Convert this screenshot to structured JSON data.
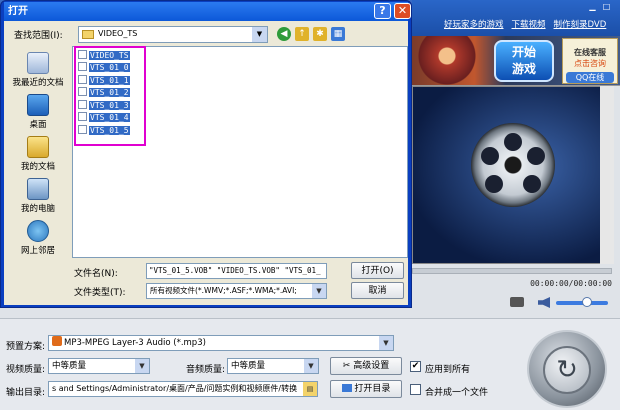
{
  "app": {
    "links": [
      "好玩家多的游戏",
      "下载视频",
      "制作刻录DVD"
    ],
    "banner": {
      "play_button": "开始\n游戏",
      "online_service": "在线客服",
      "ask_here": "点击咨询",
      "qq_online": "QQ在线"
    },
    "timecode": "00:00:00/00:00:00",
    "preset_label": "预置方案:",
    "preset_value": "MP3-MPEG Layer-3 Audio (*.mp3)",
    "video_quality_label": "视频质量:",
    "video_quality_value": "中等质量",
    "audio_quality_label": "音频质量:",
    "audio_quality_value": "中等质量",
    "advanced_button": "高级设置",
    "apply_all_label": "应用到所有",
    "apply_all_checked": true,
    "output_label": "输出目录:",
    "output_value": "s and Settings/Administrator/桌面/产品/问题实例和视频原件/转换",
    "open_dir_button": "打开目录",
    "merge_label": "合并成一个文件",
    "merge_checked": false
  },
  "dialog": {
    "title": "打开",
    "help": "?",
    "close": "✕",
    "lookin_label": "查找范围(I):",
    "lookin_value": "VIDEO_TS",
    "places": [
      "我最近的文档",
      "桌面",
      "我的文档",
      "我的电脑",
      "网上邻居"
    ],
    "files": [
      "VIDEO_TS",
      "VTS_01_0",
      "VTS_01_1",
      "VTS_01_2",
      "VTS_01_3",
      "VTS_01_4",
      "VTS_01_5"
    ],
    "filename_label": "文件名(N):",
    "filename_value": "\"VTS_01_5.VOB\" \"VIDEO_TS.VOB\" \"VTS_01_",
    "filetype_label": "文件类型(T):",
    "filetype_value": "所有视频文件(*.WMV;*.ASF;*.WMA;*.AVI;",
    "open_button": "打开(O)",
    "cancel_button": "取消"
  },
  "colors": {
    "title_bar": "#0c58d8",
    "selection": "#316ac5",
    "highlight_box": "#e000d0",
    "close_button": "#dd4c24"
  }
}
